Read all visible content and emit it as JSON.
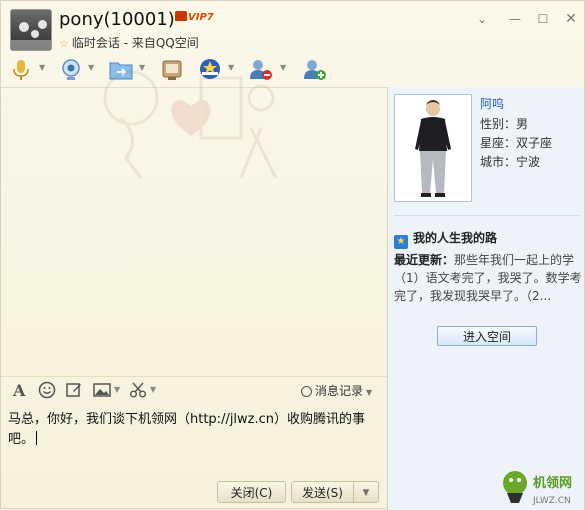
{
  "titlebar": {
    "contact_name": "pony(10001)",
    "vip_badge": "VIP7",
    "session_info": "临时会话 - 来自QQ空间"
  },
  "toolbar": {
    "icons": [
      "microphone-icon",
      "webcam-icon",
      "file-transfer-icon",
      "screen-share-icon",
      "app-center-icon",
      "remove-contact-icon",
      "add-contact-icon"
    ]
  },
  "profile": {
    "nickname": "阿呜",
    "gender_label": "性别：男",
    "zodiac_label": "星座：双子座",
    "city_label": "城市：宁波"
  },
  "space": {
    "title": "我的人生我的路",
    "update_label": "最近更新：",
    "update_text": "那些年我们一起上的学（1）语文考完了，我哭了。数学考完了，我发现我哭早了。（2...",
    "enter_button": "进入空间"
  },
  "format_bar": {
    "history_label": "消息记录"
  },
  "input": {
    "message": "马总，你好，我们谈下机领网（http://jlwz.cn）收购腾讯的事吧。"
  },
  "buttons": {
    "close_label": "关闭(C)",
    "send_label": "发送(S)"
  },
  "watermark": {
    "text": "JLWZ.CN"
  },
  "colors": {
    "window_bg": "#f8f4e3",
    "side_bg": "#eef3fa",
    "link_blue": "#1e5fb2",
    "vip_orange": "#d04c00"
  }
}
